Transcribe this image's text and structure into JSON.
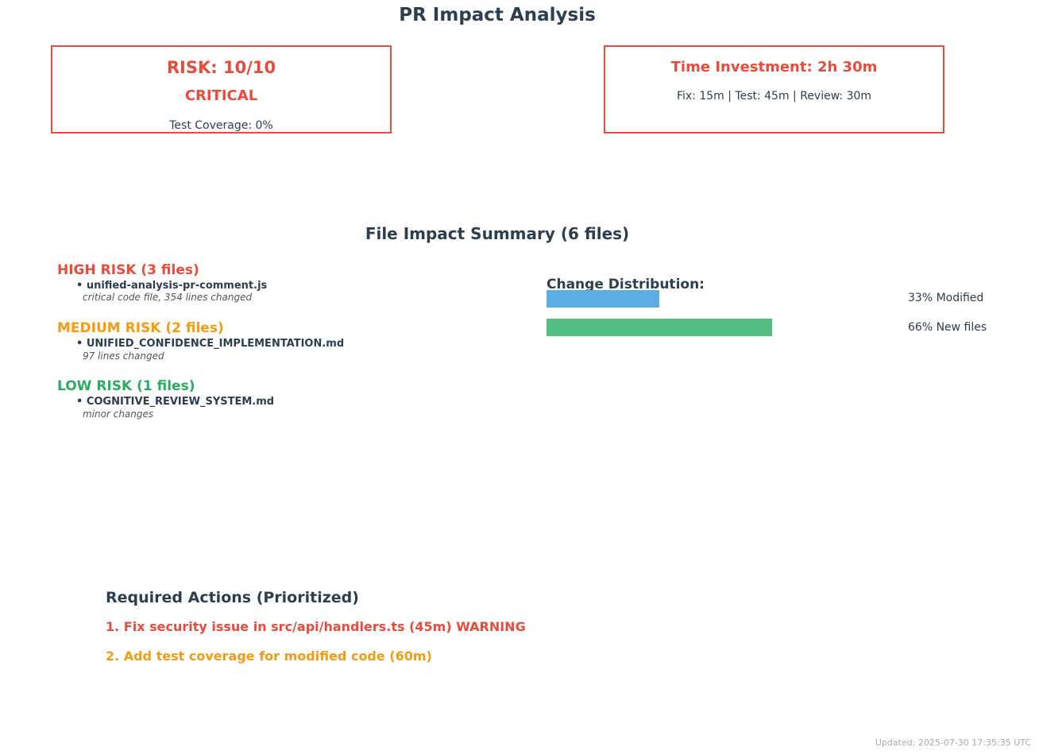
{
  "title": "PR Impact Analysis",
  "risk_card": {
    "score": "RISK: 10/10",
    "level": "CRITICAL",
    "coverage": "Test Coverage: 0%"
  },
  "time_card": {
    "total": "Time Investment: 2h 30m",
    "breakdown": "Fix: 15m | Test: 45m | Review: 30m"
  },
  "summary_title": "File Impact Summary (6 files)",
  "risk_groups": [
    {
      "heading": "HIGH RISK (3 files)",
      "color": "#e74c3c",
      "file": "• unified-analysis-pr-comment.js",
      "note": "critical code file, 354 lines changed"
    },
    {
      "heading": "MEDIUM RISK (2 files)",
      "color": "#f39c12",
      "file": "• UNIFIED_CONFIDENCE_IMPLEMENTATION.md",
      "note": "97 lines changed"
    },
    {
      "heading": "LOW RISK (1 files)",
      "color": "#27ae60",
      "file": "• COGNITIVE_REVIEW_SYSTEM.md",
      "note": "minor changes"
    }
  ],
  "chart_data": {
    "type": "bar",
    "title": "Change Distribution:",
    "orientation": "horizontal",
    "categories": [
      "Modified",
      "New files"
    ],
    "values": [
      33,
      66
    ],
    "labels": [
      "33% Modified",
      "66% New files"
    ],
    "colors": [
      "#5dade2",
      "#52be80"
    ],
    "xlim": [
      0,
      100
    ]
  },
  "actions": {
    "title": "Required Actions (Prioritized)",
    "items": [
      {
        "text": "1. Fix security issue in src/api/handlers.ts (45m) WARNING",
        "color": "#e74c3c"
      },
      {
        "text": "2. Add test coverage for modified code (60m)",
        "color": "#f39c12"
      }
    ]
  },
  "footer": "Updated: 2025-07-30 17:35:35 UTC"
}
